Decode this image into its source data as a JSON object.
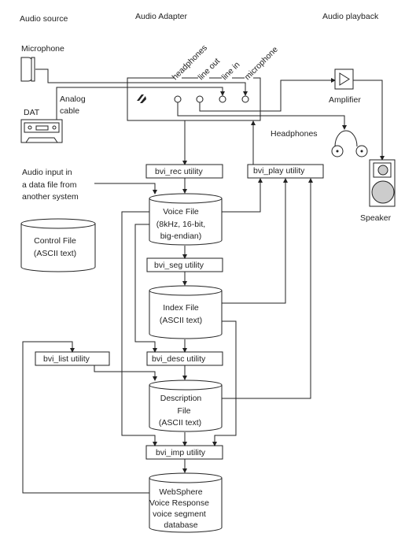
{
  "headers": {
    "source": "Audio source",
    "adapter": "Audio Adapter",
    "playback": "Audio playback"
  },
  "devices": {
    "microphone": "Microphone",
    "dat": "DAT",
    "analog_cable": [
      "Analog",
      "cable"
    ],
    "amplifier": "Amplifier",
    "headphones": "Headphones",
    "speaker": "Speaker"
  },
  "adapter_ports": [
    "headphones",
    "line out",
    "line in",
    "microphone"
  ],
  "audio_input_note": [
    "Audio input in",
    "a data file from",
    "another system"
  ],
  "utilities": {
    "rec": "bvi_rec utility",
    "play": "bvi_play utility",
    "seg": "bvi_seg utility",
    "desc": "bvi_desc utility",
    "list": "bvi_list utility",
    "imp": "bvi_imp utility"
  },
  "files": {
    "voice": [
      "Voice File",
      "(8kHz, 16-bit,",
      "big-endian)"
    ],
    "control": [
      "Control File",
      "(ASCII text)"
    ],
    "index": [
      "Index File",
      "(ASCII text)"
    ],
    "description": [
      "Description",
      "File",
      "(ASCII text)"
    ],
    "database": [
      "WebSphere",
      "Voice Response",
      "voice segment",
      "database"
    ]
  }
}
